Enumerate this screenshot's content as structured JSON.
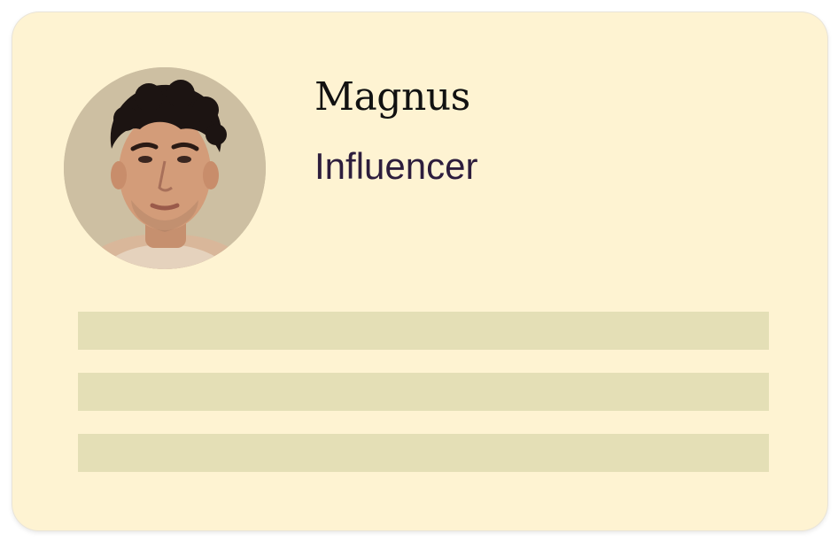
{
  "profile": {
    "name": "Magnus",
    "role": "Influencer"
  },
  "avatar": {
    "icon": "portrait-photo-icon",
    "alt": "Magnus"
  },
  "placeholder_bars": {
    "count": 3,
    "color": "#e4dfb6"
  },
  "colors": {
    "card_background": "#fef3d2",
    "name_text": "#111111",
    "role_text": "#2d1d3d"
  }
}
